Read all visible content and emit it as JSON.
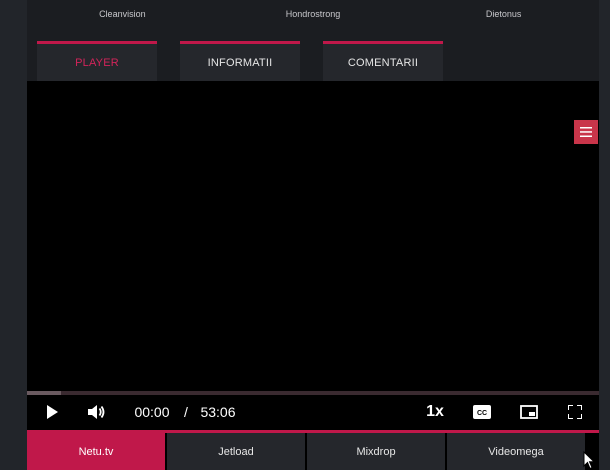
{
  "top_links": [
    "Cleanvision",
    "Hondrostrong",
    "Dietonus"
  ],
  "tabs": [
    {
      "label": "PLAYER",
      "active": true
    },
    {
      "label": "INFORMATII",
      "active": false
    },
    {
      "label": "COMENTARII",
      "active": false
    }
  ],
  "player": {
    "current_time": "00:00",
    "separator": "/",
    "duration": "53:06",
    "speed": "1x",
    "progress_buffered_fraction": 0.06,
    "icons": [
      "play-icon",
      "volume-icon",
      "captions-icon",
      "picture-in-picture-icon",
      "fullscreen-icon",
      "menu-icon"
    ]
  },
  "servers": [
    {
      "label": "Netu.tv",
      "active": true
    },
    {
      "label": "Jetload",
      "active": false
    },
    {
      "label": "Mixdrop",
      "active": false
    },
    {
      "label": "Videomega",
      "active": false
    }
  ],
  "colors": {
    "accent": "#c0184a",
    "menu_button": "#c9354a",
    "panel": "#25272c"
  }
}
